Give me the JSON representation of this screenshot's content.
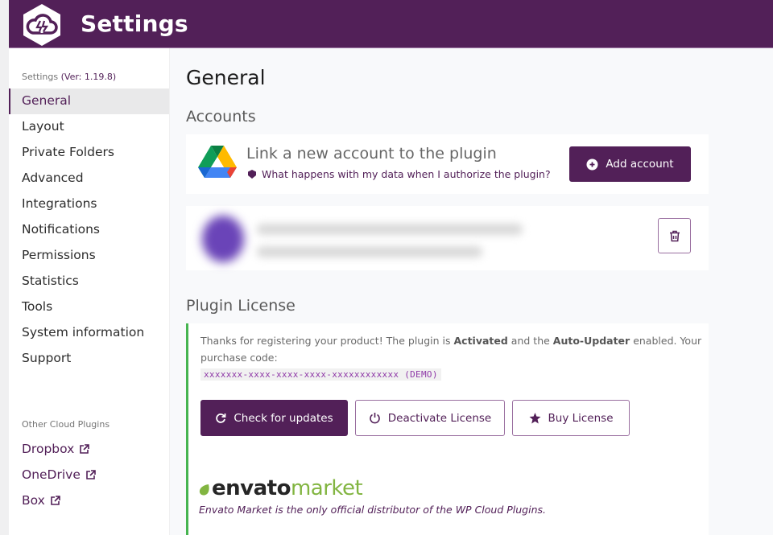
{
  "header": {
    "title": "Settings",
    "logo_icon": "wp-cloud-plugins-logo"
  },
  "sidebar": {
    "version_prefix": "Settings",
    "version": "(Ver: 1.19.8)",
    "items": [
      {
        "label": "General",
        "active": true
      },
      {
        "label": "Layout"
      },
      {
        "label": "Private Folders"
      },
      {
        "label": "Advanced"
      },
      {
        "label": "Integrations"
      },
      {
        "label": "Notifications"
      },
      {
        "label": "Permissions"
      },
      {
        "label": "Statistics"
      },
      {
        "label": "Tools"
      },
      {
        "label": "System information"
      },
      {
        "label": "Support"
      }
    ],
    "other_label": "Other Cloud Plugins",
    "other_links": [
      {
        "label": "Dropbox",
        "icon": "external-link-icon"
      },
      {
        "label": "OneDrive",
        "icon": "external-link-icon"
      },
      {
        "label": "Box",
        "icon": "external-link-icon"
      }
    ]
  },
  "main": {
    "title": "General",
    "accounts": {
      "section_title": "Accounts",
      "link_title": "Link a new account to the plugin",
      "link_help": "What happens with my data when I authorize the plugin?",
      "add_button": "Add account",
      "linked_account": {
        "name": "(blurred)",
        "email": "(blurred)"
      }
    },
    "license": {
      "section_title": "Plugin License",
      "text_1": "Thanks for registering your product! The plugin is ",
      "status": "Activated",
      "text_2": " and the ",
      "updater": "Auto-Updater",
      "text_3": " enabled. Your purchase code:",
      "purchase_code": "xxxxxxx-xxxx-xxxx-xxxx-xxxxxxxxxxxx (DEMO)",
      "buttons": {
        "check": "Check for updates",
        "deactivate": "Deactivate License",
        "buy": "Buy License"
      },
      "envato_logo_1": "envato",
      "envato_logo_2": "market",
      "envato_tagline": "Envato Market is the only official distributor of the WP Cloud Plugins."
    }
  },
  "colors": {
    "brand": "#522058",
    "success": "#46b450",
    "envato_green": "#82b541"
  }
}
